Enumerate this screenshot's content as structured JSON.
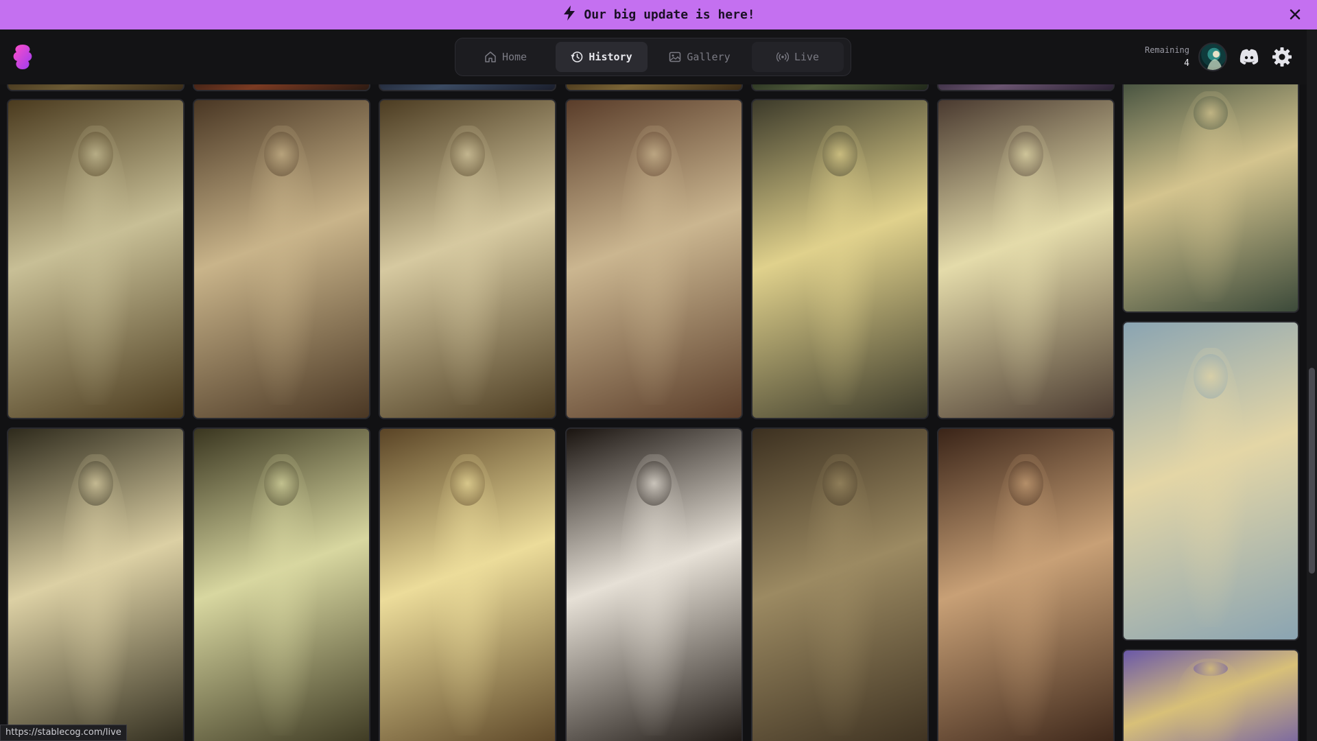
{
  "banner": {
    "text": "Our big update is here!",
    "icon": "lightning-icon",
    "close_icon": "close-icon"
  },
  "nav": {
    "tabs": [
      {
        "label": "Home",
        "icon": "home-icon",
        "active": false
      },
      {
        "label": "History",
        "icon": "history-icon",
        "active": true
      },
      {
        "label": "Gallery",
        "icon": "image-icon",
        "active": false
      },
      {
        "label": "Live",
        "icon": "broadcast-icon",
        "active": false
      }
    ]
  },
  "credits": {
    "label": "Remaining",
    "value": "4"
  },
  "header_icons": [
    "avatar",
    "discord-icon",
    "gear-icon"
  ],
  "colors": {
    "banner": "#c470f0",
    "background": "#111113",
    "nav_bg": "#1c1c20"
  },
  "gallery": {
    "images": [
      {
        "id": "r0-c0",
        "tone": [
          "#6b5a34",
          "#3a2c18"
        ]
      },
      {
        "id": "r0-c1",
        "tone": [
          "#7a3a22",
          "#2c1a12"
        ]
      },
      {
        "id": "r0-c2",
        "tone": [
          "#3a4a62",
          "#1a1e2c"
        ]
      },
      {
        "id": "r0-c3",
        "tone": [
          "#7a6436",
          "#3a2a14"
        ]
      },
      {
        "id": "r0-c4",
        "tone": [
          "#4e5a3a",
          "#20281a"
        ]
      },
      {
        "id": "r0-c5",
        "tone": [
          "#6a5470",
          "#2c2234"
        ]
      },
      {
        "id": "r1-c0",
        "tone": [
          "#c8bf96",
          "#4a3a1e"
        ]
      },
      {
        "id": "r1-c1",
        "tone": [
          "#c9b48a",
          "#4a3724"
        ]
      },
      {
        "id": "r1-c2",
        "tone": [
          "#d6c9a0",
          "#4c3c22"
        ]
      },
      {
        "id": "r1-c3",
        "tone": [
          "#cbb690",
          "#5a3d2a"
        ]
      },
      {
        "id": "r1-c4",
        "tone": [
          "#e0d18c",
          "#3c3a2a"
        ]
      },
      {
        "id": "r1-c5",
        "tone": [
          "#e4dbaa",
          "#4a3a30"
        ]
      },
      {
        "id": "r2-c0",
        "tone": [
          "#dcd0a4",
          "#2e2a1c"
        ]
      },
      {
        "id": "r2-c1",
        "tone": [
          "#d8d7a0",
          "#3a3620"
        ]
      },
      {
        "id": "r2-c2",
        "tone": [
          "#ecdc9a",
          "#5a4426"
        ]
      },
      {
        "id": "r2-c3",
        "tone": [
          "#e6e0d6",
          "#1a1410"
        ]
      },
      {
        "id": "r2-c4",
        "tone": [
          "#9c8a62",
          "#3c3020"
        ]
      },
      {
        "id": "r2-c5",
        "tone": [
          "#c8a076",
          "#3a2418"
        ]
      },
      {
        "id": "c6-a",
        "tone": [
          "#d4c48e",
          "#3c4a3a"
        ]
      },
      {
        "id": "c6-b",
        "tone": [
          "#e4d6a6",
          "#8aa4b2"
        ]
      },
      {
        "id": "c6-c",
        "tone": [
          "#d8c078",
          "#6a58a8"
        ]
      }
    ]
  },
  "status_url": "https://stablecog.com/live"
}
